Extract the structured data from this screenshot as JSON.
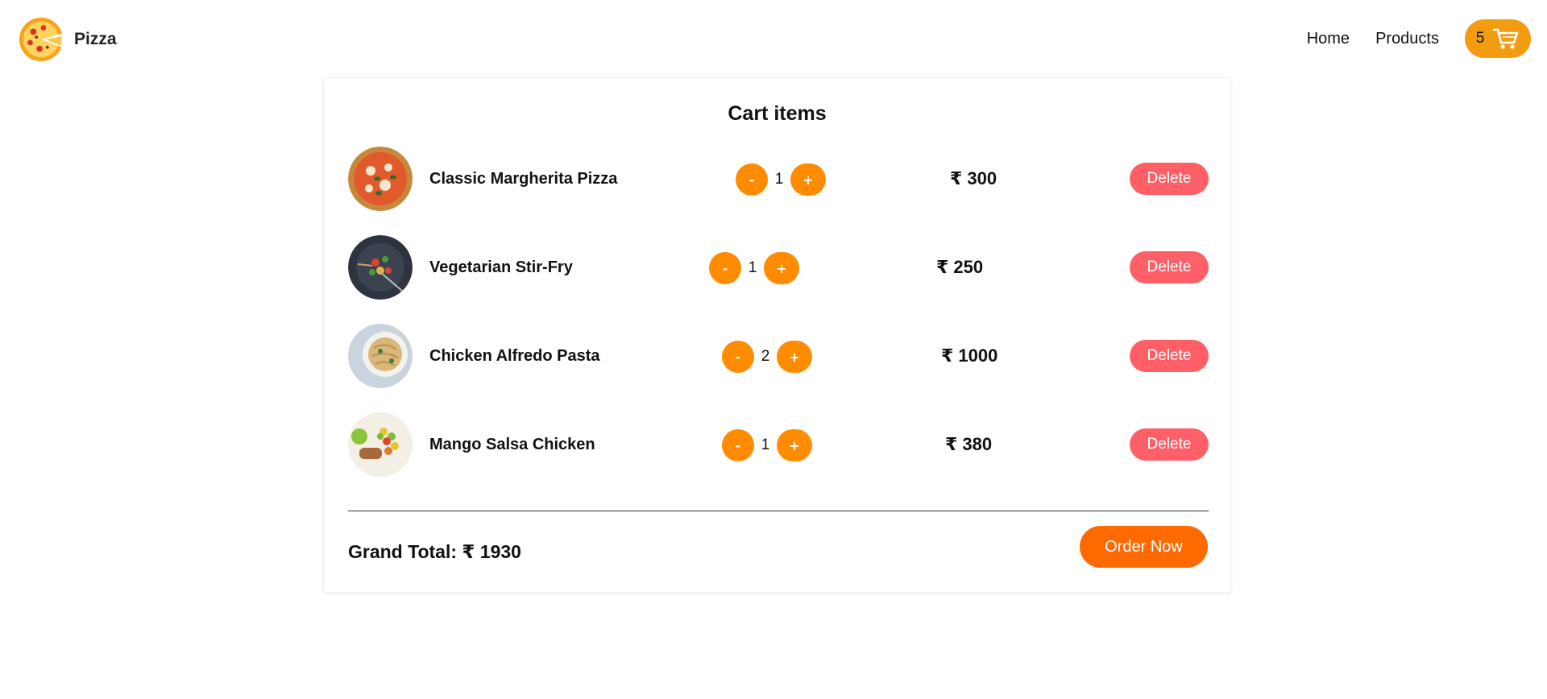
{
  "brand": {
    "name": "Pizza",
    "logo_icon": "pizza-logo-icon"
  },
  "nav": {
    "home_label": "Home",
    "products_label": "Products",
    "cart_count": "5",
    "cart_icon": "shopping-cart-icon"
  },
  "cart": {
    "title": "Cart items",
    "items": [
      {
        "name": "Classic Margherita Pizza",
        "quantity": "1",
        "price": "₹ 300",
        "minus_label": "-",
        "plus_label": "+",
        "delete_label": "Delete",
        "thumb_icon": "pizza-thumbnail"
      },
      {
        "name": "Vegetarian Stir-Fry",
        "quantity": "1",
        "price": "₹ 250",
        "minus_label": "-",
        "plus_label": "+",
        "delete_label": "Delete",
        "thumb_icon": "stir-fry-thumbnail"
      },
      {
        "name": "Chicken Alfredo Pasta",
        "quantity": "2",
        "price": "₹ 1000",
        "minus_label": "-",
        "plus_label": "+",
        "delete_label": "Delete",
        "thumb_icon": "pasta-thumbnail"
      },
      {
        "name": "Mango Salsa Chicken",
        "quantity": "1",
        "price": "₹ 380",
        "minus_label": "-",
        "plus_label": "+",
        "delete_label": "Delete",
        "thumb_icon": "chicken-salsa-thumbnail"
      }
    ],
    "grand_total_label": "Grand Total:",
    "grand_total_value": "₹ 1930",
    "order_label": "Order Now"
  },
  "colors": {
    "accent_orange": "#ff8c00",
    "cart_pill": "#f39c12",
    "delete_red": "#ff6068",
    "order_orange": "#ff6a00"
  }
}
